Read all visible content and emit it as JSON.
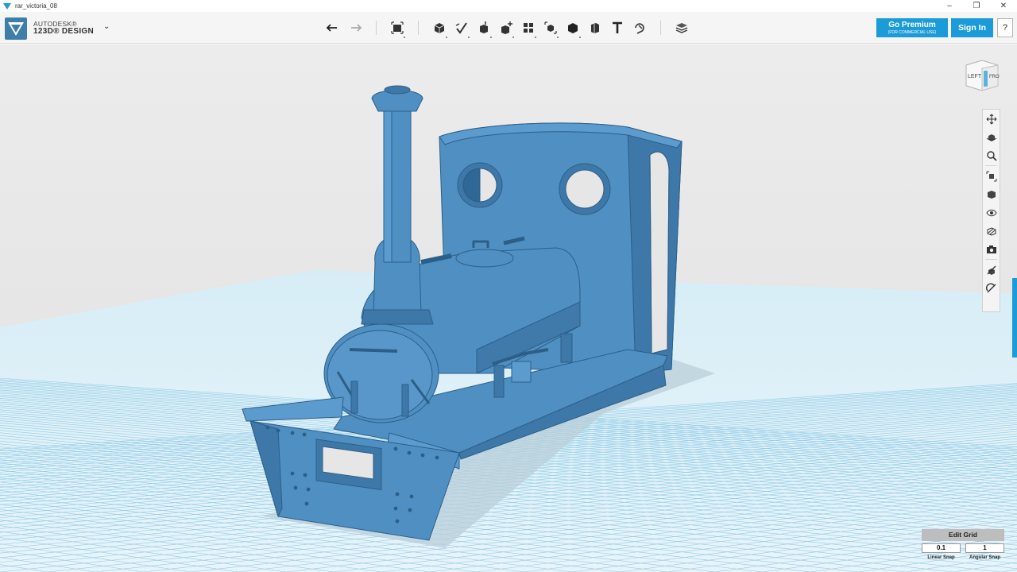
{
  "window": {
    "title": "rar_victoria_08",
    "minimize": "–",
    "maximize": "❐",
    "close": "✕"
  },
  "brand": {
    "top": "AUTODESK®",
    "bottom": "123D® DESIGN",
    "menu_icon": "chevron-down-icon"
  },
  "toolbar": {
    "history": [
      {
        "name": "undo-icon"
      },
      {
        "name": "redo-icon"
      }
    ],
    "transform": {
      "name": "transform-icon"
    },
    "tools": [
      {
        "name": "primitives-icon"
      },
      {
        "name": "sketch-icon"
      },
      {
        "name": "construct-icon"
      },
      {
        "name": "modify-icon"
      },
      {
        "name": "pattern-icon"
      },
      {
        "name": "grouping-icon"
      },
      {
        "name": "combine-icon"
      },
      {
        "name": "measure-icon"
      },
      {
        "name": "text-icon"
      },
      {
        "name": "snap-icon"
      }
    ],
    "material": {
      "name": "material-icon"
    }
  },
  "account": {
    "premium_label": "Go Premium",
    "premium_sub": "(FOR COMMERCIAL USE)",
    "signin_label": "Sign In",
    "help_label": "?"
  },
  "viewcube": {
    "left_face": "LEFT",
    "front_face": "FRO"
  },
  "navbar": [
    {
      "name": "pan-icon"
    },
    {
      "name": "orbit-icon"
    },
    {
      "name": "zoom-icon"
    },
    {
      "name": "fit-icon"
    },
    {
      "name": "views-icon"
    },
    {
      "name": "visibility-icon"
    },
    {
      "name": "materials-outlines-icon"
    },
    {
      "name": "camera-icon"
    },
    {
      "name": "show-hide-icon"
    },
    {
      "name": "snap-toggle-icon"
    }
  ],
  "grid": {
    "title": "Edit Grid",
    "linear_snap_value": "0.1",
    "angular_snap_value": "1",
    "linear_snap_label": "Linear Snap",
    "angular_snap_label": "Angular Snap"
  },
  "colors": {
    "accent": "#1b9bd7",
    "model": "#4f8fc2",
    "background": "#e6e6e6",
    "grid_line": "#7cc4e4"
  }
}
